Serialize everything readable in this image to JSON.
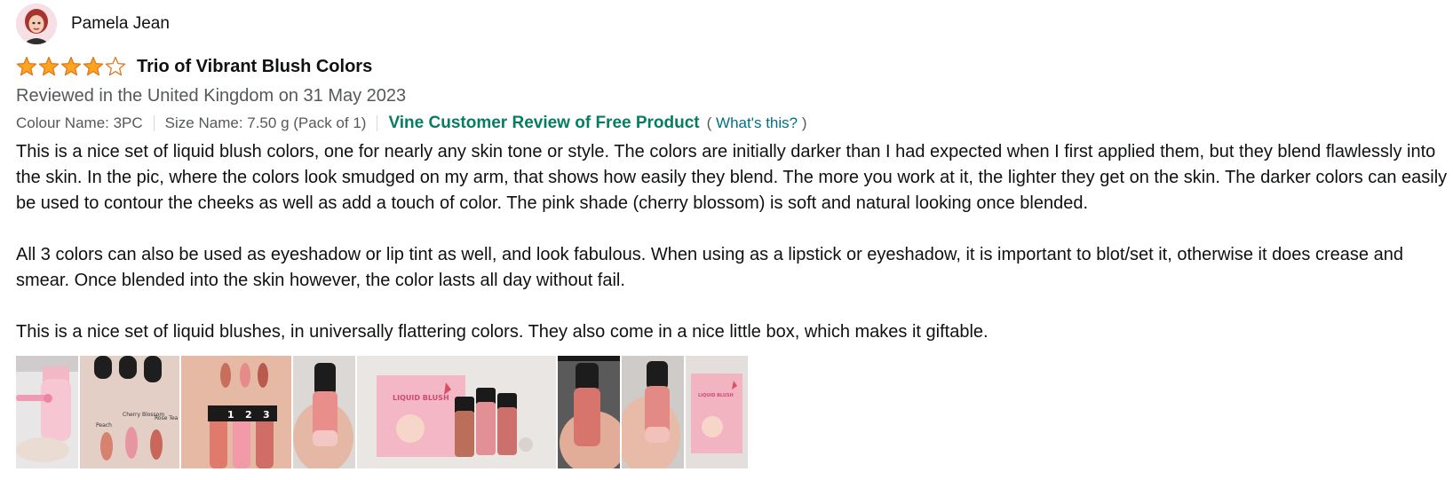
{
  "profile": {
    "name": "Pamela Jean"
  },
  "review": {
    "rating": 4,
    "rating_max": 5,
    "title": "Trio of Vibrant Blush Colors",
    "date_line": "Reviewed in the United Kingdom on 31 May 2023",
    "colour_name": "Colour Name: 3PC",
    "size_name": "Size Name: 7.50 g (Pack of 1)",
    "vine_label": "Vine Customer Review of Free Product",
    "whats_this_open": "(",
    "whats_this_link": "What's this?",
    "whats_this_close": ")",
    "paragraphs": [
      "This is a nice set of liquid blush colors, one for nearly any skin tone or style. The colors are initially darker than I had expected when I first applied them, but they blend flawlessly into the skin. In the pic, where the colors look smudged on my arm, that shows how easily they blend. The more you work at it, the lighter they get on the skin. The darker colors can easily be used to contour the cheeks as well as add a touch of color. The pink shade (cherry blossom) is soft and natural looking once blended.",
      "All 3 colors can also be used as eyeshadow or lip tint as well, and look fabulous. When using as a lipstick or eyeshadow, it is important to blot/set it, otherwise it does crease and smear. Once blended into the skin however, the color lasts all day without fail.",
      "This is a nice set of liquid blushes, in universally flattering colors. They also come in a nice little box, which makes it giftable."
    ]
  },
  "images": {
    "swatch_labels": [
      "Cherry Blossom",
      "Rose Tea",
      "Peach"
    ],
    "bottle_numbers": [
      "1",
      "2",
      "3"
    ],
    "box_label": "LIQUID BLUSH"
  },
  "colors": {
    "star_fill": "#ffa41c",
    "star_stroke": "#de7921",
    "vine_green": "#067d62",
    "link": "#007185",
    "secondary_text": "#565959"
  }
}
